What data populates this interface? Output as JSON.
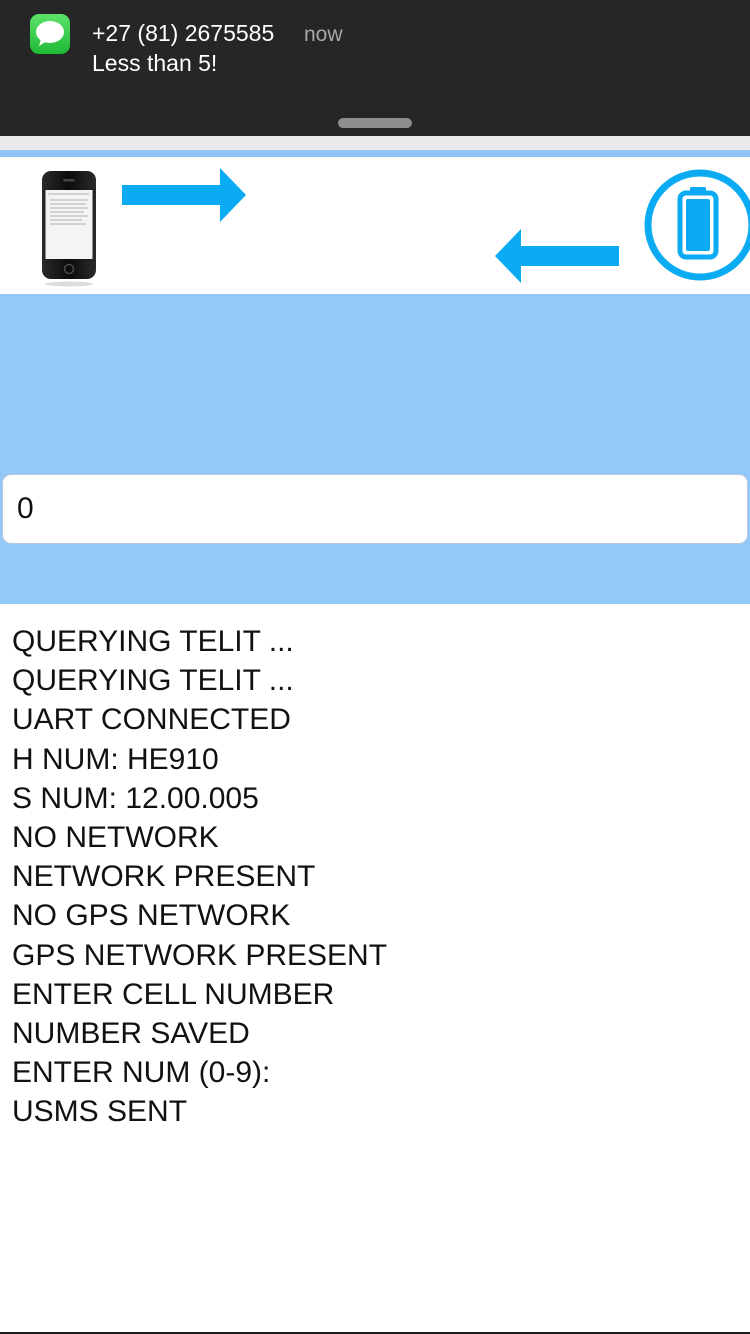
{
  "notification": {
    "sender": "+27 (81) 2675585",
    "time": "now",
    "message": "Less than 5!",
    "app_icon": "messages-icon"
  },
  "header": {
    "left_icon": "phone-icon",
    "send_arrow_icon": "arrow-right-icon",
    "receive_arrow_icon": "arrow-left-icon",
    "right_icon": "battery-icon",
    "accent_color": "#0aabf2"
  },
  "input": {
    "value": "0"
  },
  "log": [
    "QUERYING TELIT ...",
    "QUERYING TELIT ...",
    "UART CONNECTED",
    "H NUM: HE910",
    "S NUM: 12.00.005",
    "NO NETWORK",
    "NETWORK PRESENT",
    "NO GPS NETWORK",
    "GPS NETWORK PRESENT",
    "ENTER CELL NUMBER",
    "NUMBER SAVED",
    "ENTER NUM (0-9):",
    "USMS SENT"
  ]
}
